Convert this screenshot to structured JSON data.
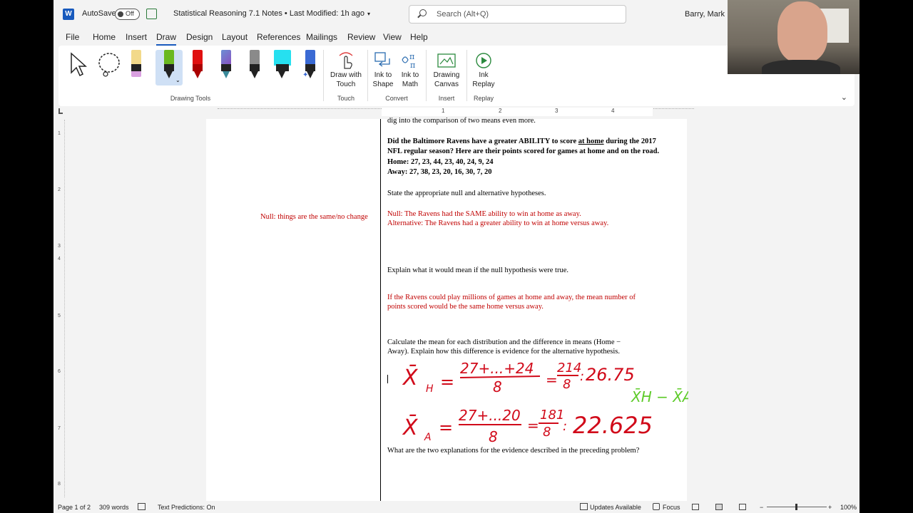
{
  "titlebar": {
    "app_icon": "word-logo-icon",
    "app_letter": "W",
    "autosave_label": "AutoSave",
    "autosave_state": "Off",
    "doc_title": "Statistical Reasoning 7.1 Notes • Last Modified: 1h ago",
    "search_placeholder": "Search (Alt+Q)",
    "user_name": "Barry, Mark"
  },
  "menu": {
    "tabs": [
      "File",
      "Home",
      "Insert",
      "Draw",
      "Design",
      "Layout",
      "References",
      "Mailings",
      "Review",
      "View",
      "Help"
    ],
    "active_tab": "Draw"
  },
  "ribbon": {
    "groups": {
      "drawing_tools": "Drawing Tools",
      "touch": "Touch",
      "convert": "Convert",
      "insert": "Insert",
      "replay": "Replay"
    },
    "buttons": {
      "draw_with_touch_1": "Draw with",
      "draw_with_touch_2": "Touch",
      "ink_to_shape_1": "Ink to",
      "ink_to_shape_2": "Shape",
      "ink_to_math_1": "Ink to",
      "ink_to_math_2": "Math",
      "drawing_canvas_1": "Drawing",
      "drawing_canvas_2": "Canvas",
      "ink_replay_1": "Ink",
      "ink_replay_2": "Replay"
    },
    "pen_colors": {
      "highlighter_yellow": "#f2d98a",
      "pen_green": "#6ab820",
      "pen_red": "#e01010",
      "pen_galaxy": "#6b8fd4",
      "pencil_gray": "#8a8a8a",
      "highlighter_cyan": "#26e0f0",
      "pen_blue": "#3a6ad4"
    }
  },
  "ruler": {
    "h_numbers": [
      "1",
      "2",
      "3",
      "4"
    ],
    "v_numbers": [
      "1",
      "2",
      "3",
      "4",
      "5",
      "6",
      "7",
      "8"
    ]
  },
  "document": {
    "line_cut": "dig into the comparison of two means even more.",
    "q_bold_1a": "Did the Baltimore Ravens have a greater ABILITY to score ",
    "q_bold_1b": "at home",
    "q_bold_1c": " during the 2017",
    "q_bold_2": "NFL regular season? Here are their points scored for games at home and on the road.",
    "home": "Home: 27, 23, 44, 23, 40, 24, 9, 24",
    "away": "Away: 27, 38, 23, 20, 16, 30, 7, 20",
    "q_hyp": "State the appropriate null and alternative hypotheses.",
    "null_ans": "Null: The Ravens had the SAME ability to win at home as away.",
    "alt_ans": "Alternative: The Ravens had a greater ability to win at home versus away.",
    "margin_comment": "Null: things are the same/no change",
    "q_null_mean": "Explain what it would mean if the null hypothesis were true.",
    "ans_null_1": "If the Ravens could play millions of games at home and away, the mean number of",
    "ans_null_2": "points scored would be the same home versus away.",
    "q_calc_1": "Calculate the mean for each distribution and the difference in means (Home −",
    "q_calc_2": "Away). Explain how this difference is evidence for the alternative hypothesis.",
    "q_two_expl": "What are the two explanations for the evidence described in the preceding problem?"
  },
  "ink": {
    "line1_xbar": "X̄",
    "line1_sub": "H",
    "line1_num": "27+...+24",
    "line1_den": "8",
    "line1_frac_num": "214",
    "line1_frac_den": "8",
    "line1_result": "26.75",
    "line2_xbar": "X̄",
    "line2_sub": "A",
    "line2_num": "27+...20",
    "line2_den": "8",
    "line2_frac_num": "181",
    "line2_frac_den": "8",
    "line2_result": "22.625",
    "green_diff": "X̄H − X̄A =",
    "red_color": "#d10a1a",
    "green_color": "#5ecb2a"
  },
  "status": {
    "page": "Page 1 of 2",
    "words": "309 words",
    "text_predictions": "Text Predictions: On",
    "updates": "Updates Available",
    "focus": "Focus",
    "zoom": "100%",
    "zoom_minus": "−",
    "zoom_plus": "+"
  }
}
